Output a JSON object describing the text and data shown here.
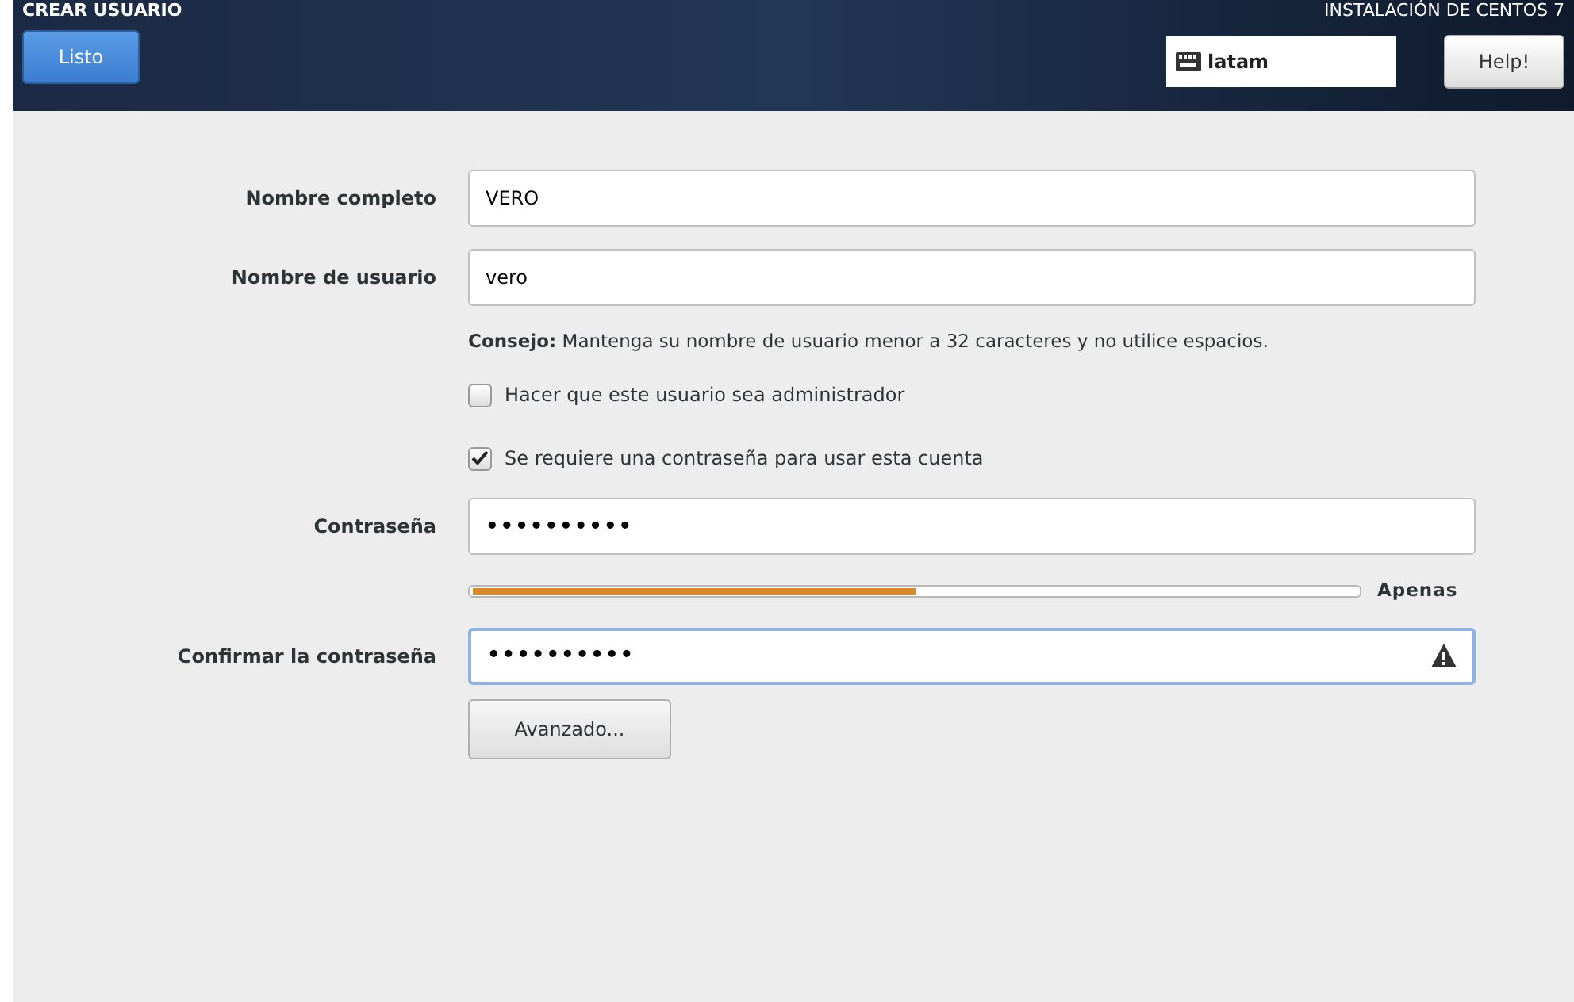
{
  "header": {
    "title": "CREAR USUARIO",
    "product": "INSTALACIÓN DE CENTOS 7",
    "done_button": "Listo",
    "keyboard": "latam",
    "help_button": "Help!"
  },
  "fields": [
    {
      "label": "Nombre completo",
      "value": "VERO",
      "focused": false
    },
    {
      "label": "Nombre de usuario",
      "value": "vero",
      "focused": false
    }
  ],
  "tip": "**Consejo:** Mantenga su nombre de usuario menor a 32 caracteres y no utilice espacios.",
  "checkboxes": [
    {
      "label": "Hacer que este usuario sea administrador",
      "checked": false
    },
    {
      "label": "Se requiere una contraseña para usar esta cuenta",
      "checked": true
    }
  ],
  "password": {
    "label": "Contraseña",
    "value": "••••••••••",
    "focused": false
  },
  "strength": {
    "level": 0.5,
    "reading": "Apenas"
  },
  "confirm": {
    "label": "Confirmar la contraseña",
    "value": "••••••••••",
    "focused": true,
    "warning": true
  },
  "advanced_button": "Avanzado..."
}
